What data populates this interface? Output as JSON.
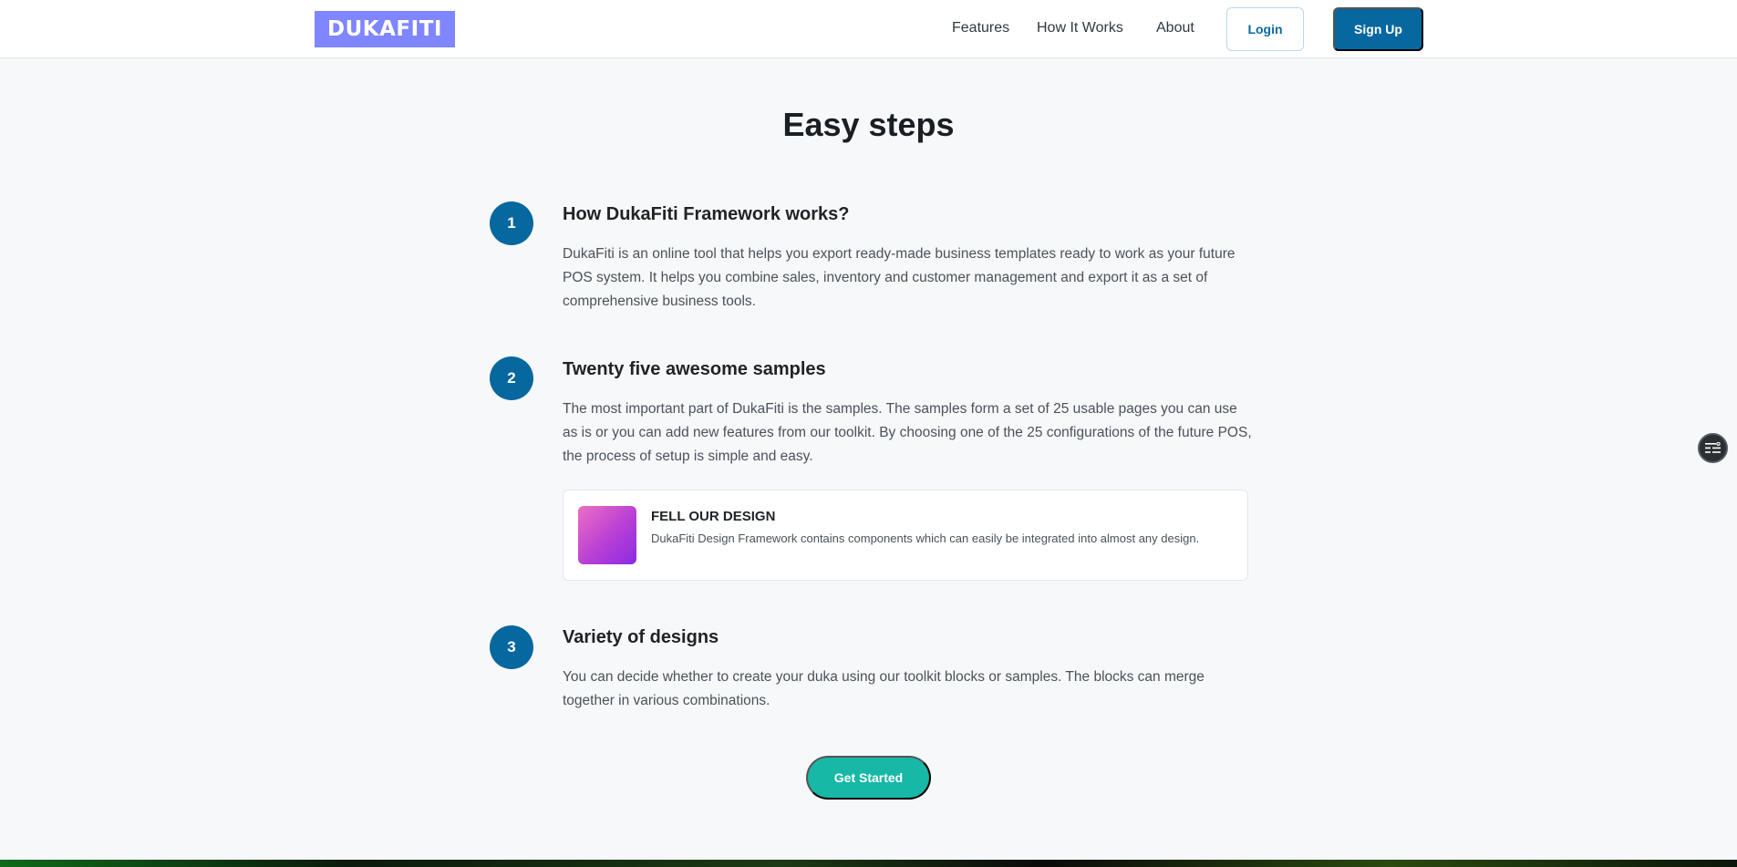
{
  "header": {
    "logo": "DUKAFITI",
    "nav": [
      "Features",
      "How It Works",
      "About"
    ],
    "login_label": "Login",
    "signup_label": "Sign Up"
  },
  "section": {
    "title": "Easy steps"
  },
  "steps": [
    {
      "number": "1",
      "title": "How DukaFiti Framework works?",
      "text": "DukaFiti is an online tool that helps you export ready-made business templates ready to work as your future POS system. It helps you combine sales, inventory and customer management and export it as a set of comprehensive business tools."
    },
    {
      "number": "2",
      "title": "Twenty five awesome samples",
      "text": "The most important part of DukaFiti is the samples. The samples form a set of 25 usable pages you can use as is or you can add new features from our toolkit. By choosing one of the 25 configurations of the future POS, the process of setup is simple and easy."
    },
    {
      "number": "3",
      "title": "Variety of designs",
      "text": "You can decide whether to create your duka using our toolkit blocks or samples. The blocks can merge together in various combinations."
    }
  ],
  "feature_card": {
    "title": "FELL OUR DESIGN",
    "description": "DukaFiti Design Framework contains components which can easily be integrated into almost any design."
  },
  "cta": {
    "label": "Get Started"
  },
  "widget": {
    "icon": "list-settings-icon"
  },
  "colors": {
    "primary": "#07679f",
    "logo_bg": "#7f86ff",
    "cta": "#17b8a6",
    "background": "#f7f8fa"
  }
}
